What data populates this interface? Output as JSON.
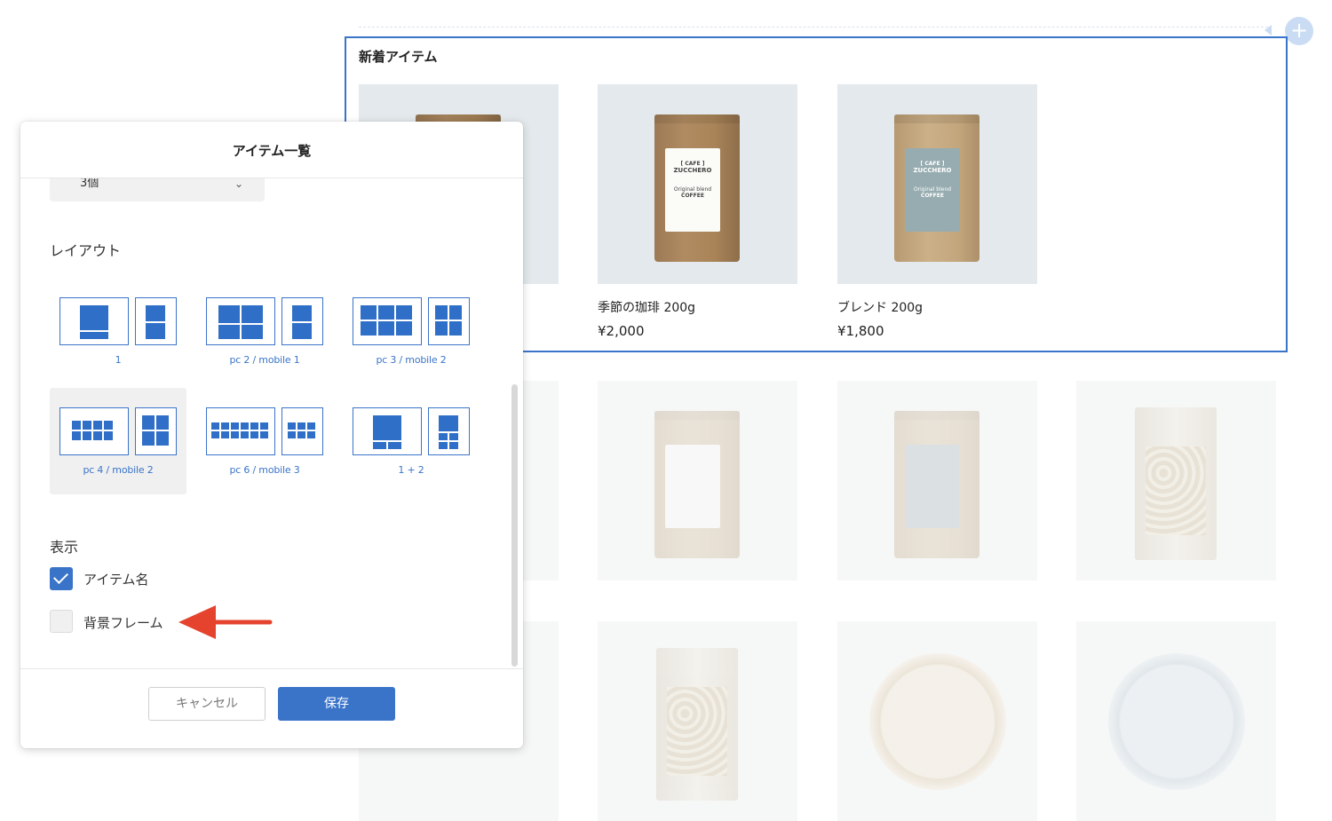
{
  "storefront": {
    "section_title": "新着アイテム",
    "add_section_symbol": "+",
    "featured_items": [
      {
        "name": "",
        "price": "",
        "image": "coffee-bag-kraft"
      },
      {
        "name": "季節の珈琲 200g",
        "price": "¥2,000",
        "image": "coffee-bag-kraft"
      },
      {
        "name": "ブレンド 200g",
        "price": "¥1,800",
        "image": "coffee-bag-blue-label"
      }
    ],
    "bag_label": {
      "line1": "[ CAFE ]",
      "line2": "ZUCCHERO",
      "line3": "Original blend",
      "line4": "COFFEE"
    }
  },
  "modal": {
    "title": "アイテム一覧",
    "count_select": {
      "value": "3個",
      "icon": "chevron-down-icon"
    },
    "layout_section_label": "レイアウト",
    "layout_options": [
      {
        "id": "1",
        "caption": "1",
        "selected": false
      },
      {
        "id": "pc2-mobile1",
        "caption": "pc 2 / mobile 1",
        "selected": false
      },
      {
        "id": "pc3-mobile2",
        "caption": "pc 3 / mobile 2",
        "selected": false
      },
      {
        "id": "pc4-mobile2",
        "caption": "pc 4 / mobile 2",
        "selected": true
      },
      {
        "id": "pc6-mobile3",
        "caption": "pc 6 / mobile 3",
        "selected": false
      },
      {
        "id": "1plus2",
        "caption": "1 + 2",
        "selected": false
      }
    ],
    "display_section_label": "表示",
    "checkboxes": [
      {
        "label": "アイテム名",
        "checked": true
      },
      {
        "label": "背景フレーム",
        "checked": false
      }
    ],
    "cancel_label": "キャンセル",
    "save_label": "保存"
  },
  "colors": {
    "accent": "#3a74c9",
    "annotation_arrow": "#e5432e"
  }
}
